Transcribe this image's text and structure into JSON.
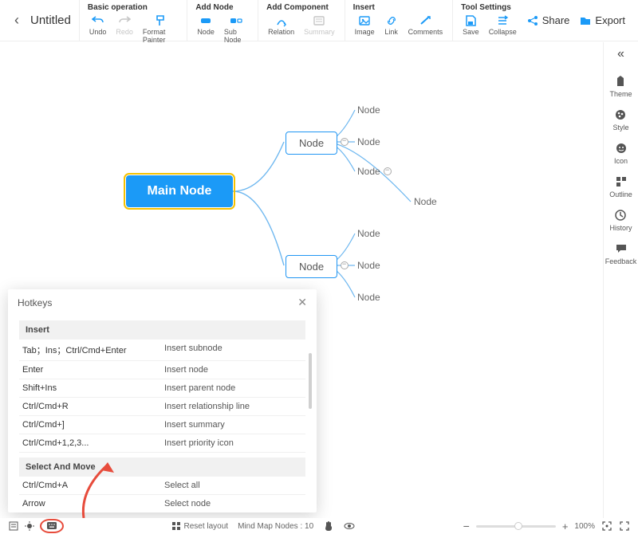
{
  "title": "Untitled",
  "toolbar": {
    "groups": [
      {
        "label": "Basic operation",
        "items": [
          "Undo",
          "Redo",
          "Format Painter"
        ]
      },
      {
        "label": "Add Node",
        "items": [
          "Node",
          "Sub Node"
        ]
      },
      {
        "label": "Add Component",
        "items": [
          "Relation",
          "Summary"
        ]
      },
      {
        "label": "Insert",
        "items": [
          "Image",
          "Link",
          "Comments"
        ]
      },
      {
        "label": "Tool Settings",
        "items": [
          "Save",
          "Collapse"
        ]
      }
    ],
    "share": "Share",
    "export": "Export"
  },
  "sidebar": {
    "collapse": "«",
    "items": [
      "Theme",
      "Style",
      "Icon",
      "Outline",
      "History",
      "Feedback"
    ]
  },
  "mindmap": {
    "main": "Main Node",
    "node1": "Node",
    "node2": "Node",
    "leaves": [
      "Node",
      "Node",
      "Node",
      "Node",
      "Node",
      "Node",
      "Node"
    ]
  },
  "hotkeys": {
    "title": "Hotkeys",
    "sections": [
      {
        "title": "Insert",
        "rows": [
          {
            "k": "Tab；Ins；Ctrl/Cmd+Enter",
            "a": "Insert subnode"
          },
          {
            "k": "Enter",
            "a": "Insert node"
          },
          {
            "k": "Shift+Ins",
            "a": "Insert parent node"
          },
          {
            "k": "Ctrl/Cmd+R",
            "a": "Insert relationship line"
          },
          {
            "k": "Ctrl/Cmd+]",
            "a": "Insert summary"
          },
          {
            "k": "Ctrl/Cmd+1,2,3...",
            "a": "Insert priority icon"
          }
        ]
      },
      {
        "title": "Select And Move",
        "rows": [
          {
            "k": "Ctrl/Cmd+A",
            "a": "Select all"
          },
          {
            "k": "Arrow",
            "a": "Select node"
          }
        ]
      }
    ]
  },
  "bottom": {
    "reset": "Reset layout",
    "nodes_label": "Mind Map Nodes :",
    "nodes_count": "10",
    "zoom": "100%",
    "minus": "−",
    "plus": "+"
  }
}
